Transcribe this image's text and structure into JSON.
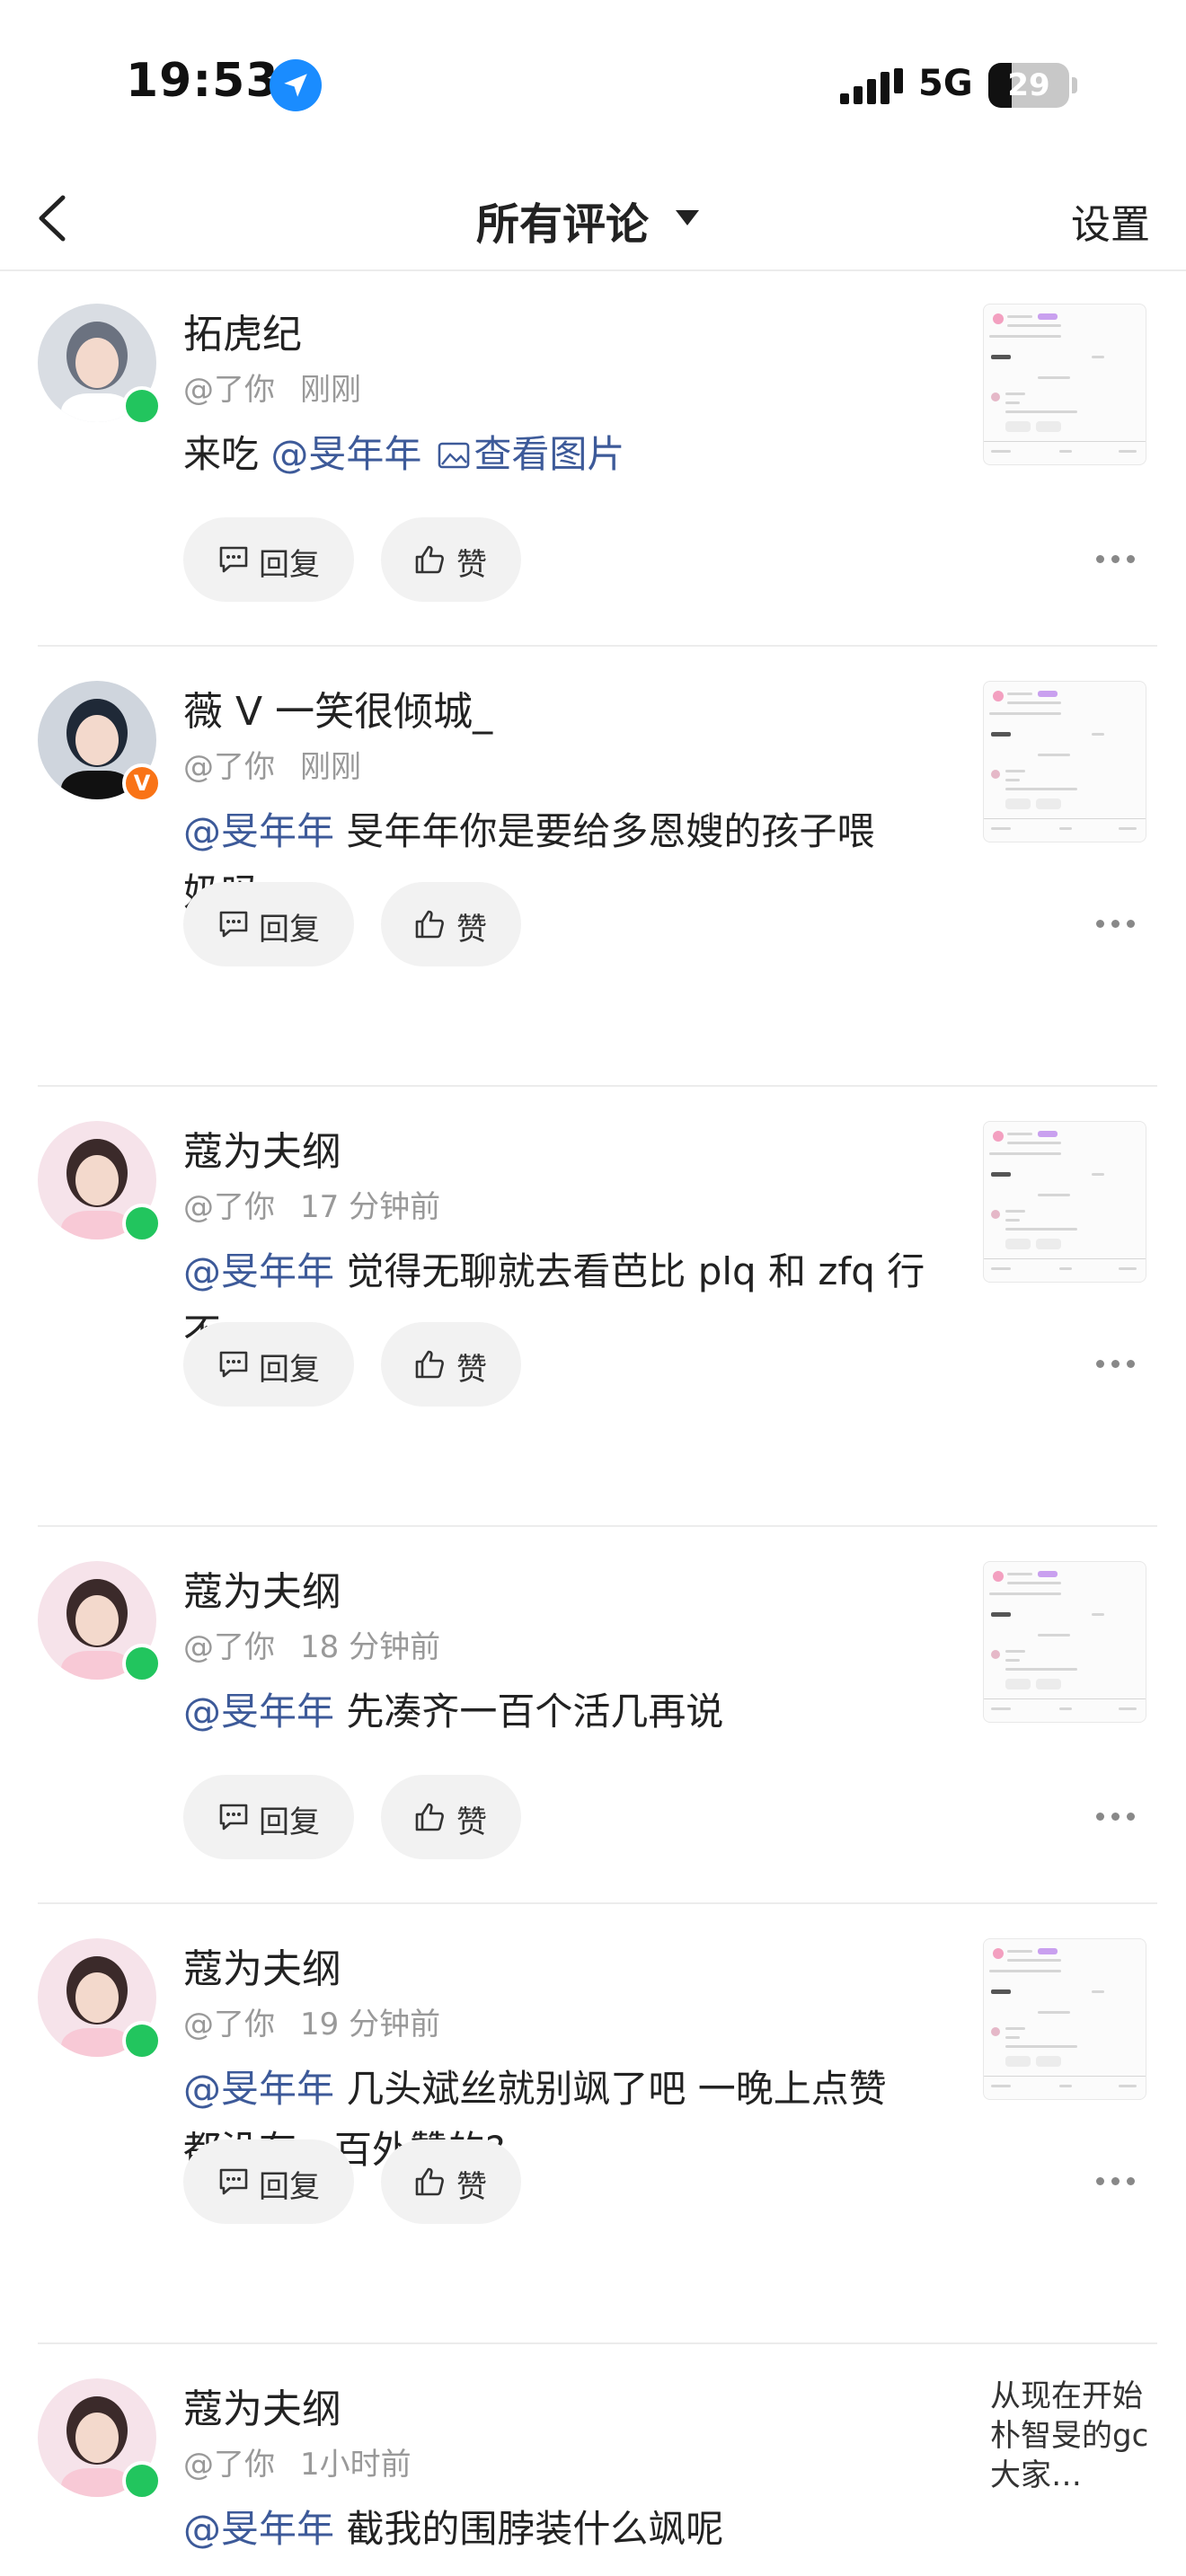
{
  "status_bar": {
    "time": "19:53",
    "network": "5G",
    "battery": "29",
    "battery_level": 0.29
  },
  "nav": {
    "title": "所有评论",
    "settings": "设置"
  },
  "buttons": {
    "reply": "回复",
    "like": "赞"
  },
  "comments": [
    {
      "username": "拓虎纪",
      "mention_label": "@了你",
      "time": "刚刚",
      "badge": "online",
      "text_before": "来吃 ",
      "mention": "@旻年年",
      "text_after": "",
      "image_link": "查看图片",
      "line2": ""
    },
    {
      "username": "薇 V 一笑很倾城_",
      "mention_label": "@了你",
      "time": "刚刚",
      "badge": "verified",
      "badge_text": "V",
      "text_before": "",
      "mention": "@旻年年",
      "text_after": " 旻年年你是要给多恩嫂的孩子喂",
      "line2": "奶吗"
    },
    {
      "username": "蔻为夫纲",
      "mention_label": "@了你",
      "time": "17 分钟前",
      "badge": "online",
      "text_before": "",
      "mention": "@旻年年",
      "text_after": " 觉得无聊就去看芭比 plq 和 zfq 行",
      "line2": "不"
    },
    {
      "username": "蔻为夫纲",
      "mention_label": "@了你",
      "time": "18 分钟前",
      "badge": "online",
      "text_before": "",
      "mention": "@旻年年",
      "text_after": " 先凑齐一百个活几再说",
      "line2": ""
    },
    {
      "username": "蔻为夫纲",
      "mention_label": "@了你",
      "time": "19 分钟前",
      "badge": "online",
      "text_before": "",
      "mention": "@旻年年",
      "text_after": " 几头斌丝就别飒了吧 一晚上点赞",
      "line2": "都没有一百外赞的?"
    },
    {
      "username": "蔻为夫纲",
      "mention_label": "@了你",
      "time": "1小时前",
      "badge": "online",
      "text_before": "",
      "mention": "@旻年年",
      "text_after": " 截我的围脖装什么飒呢",
      "line2": "",
      "thumb_text": "从现在开始朴智旻的gc大家…"
    }
  ],
  "colors": {
    "mention": "#3d5a99",
    "online": "#22c55e",
    "verified": "#f97316"
  }
}
